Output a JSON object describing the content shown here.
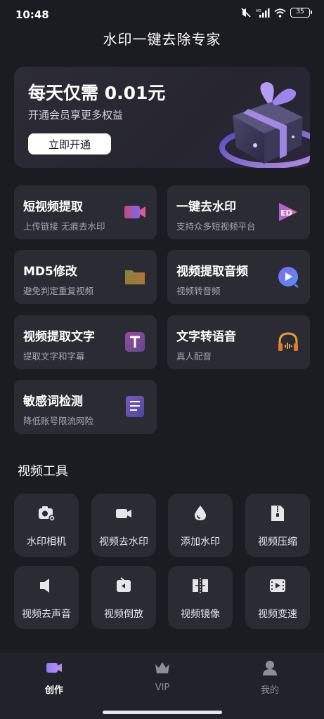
{
  "status_bar": {
    "time": "10:48",
    "battery": "35"
  },
  "app_title": "水印一键去除专家",
  "banner": {
    "title": "每天仅需 0.01元",
    "subtitle": "开通会员享更多权益",
    "button": "立即开通"
  },
  "features": [
    {
      "title": "短视频提取",
      "sub": "上传链接 无痕去水印",
      "icon": "video-camera-icon"
    },
    {
      "title": "一键去水印",
      "sub": "支持众多短视频平台",
      "icon": "play-badge-icon"
    },
    {
      "title": "MD5修改",
      "sub": "避免判定重复视频",
      "icon": "folder-icon"
    },
    {
      "title": "视频提取音频",
      "sub": "视频转音频",
      "icon": "audio-play-icon"
    },
    {
      "title": "视频提取文字",
      "sub": "提取文字和字幕",
      "icon": "text-t-icon"
    },
    {
      "title": "文字转语音",
      "sub": "真人配音",
      "icon": "headphones-icon"
    },
    {
      "title": "敏感词检测",
      "sub": "降低账号限流网险",
      "icon": "document-lines-icon"
    }
  ],
  "tools_section_title": "视频工具",
  "tools": [
    {
      "label": "水印相机",
      "icon": "camera-icon"
    },
    {
      "label": "视频去水印",
      "icon": "video-icon"
    },
    {
      "label": "添加水印",
      "icon": "droplet-icon"
    },
    {
      "label": "视频压缩",
      "icon": "zip-file-icon"
    },
    {
      "label": "视频去声音",
      "icon": "speaker-icon"
    },
    {
      "label": "视频倒放",
      "icon": "rewind-icon"
    },
    {
      "label": "视频镜像",
      "icon": "mirror-icon"
    },
    {
      "label": "视频变速",
      "icon": "film-speed-icon"
    }
  ],
  "nav": [
    {
      "label": "创作",
      "icon": "create-video-icon",
      "active": true
    },
    {
      "label": "VIP",
      "icon": "crown-icon",
      "active": false
    },
    {
      "label": "我的",
      "icon": "profile-icon",
      "active": false
    }
  ],
  "colors": {
    "background": "#1b1b22",
    "card": "#2b2b33",
    "accent": "#8f7cf5"
  }
}
